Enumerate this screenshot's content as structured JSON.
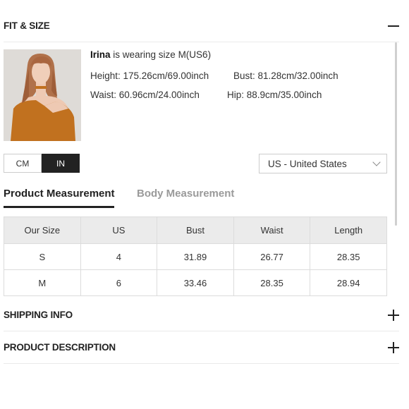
{
  "fit": {
    "title": "FIT & SIZE"
  },
  "model": {
    "name": "Irina",
    "wearing_text": "is wearing size M(US6)",
    "height": "Height: 175.26cm/69.00inch",
    "bust": "Bust: 81.28cm/32.00inch",
    "waist": "Waist: 60.96cm/24.00inch",
    "hip": "Hip: 88.9cm/35.00inch"
  },
  "units": {
    "cm": "CM",
    "in": "IN",
    "selected": "IN"
  },
  "country": {
    "selected": "US - United States"
  },
  "tabs": {
    "product": "Product Measurement",
    "body": "Body Measurement",
    "active": "product"
  },
  "table": {
    "headers": [
      "Our Size",
      "US",
      "Bust",
      "Waist",
      "Length"
    ],
    "rows": [
      [
        "S",
        "4",
        "31.89",
        "26.77",
        "28.35"
      ],
      [
        "M",
        "6",
        "33.46",
        "28.35",
        "28.94"
      ],
      [
        "",
        "",
        "",
        "",
        ""
      ]
    ]
  },
  "shipping": {
    "title": "SHIPPING INFO"
  },
  "description": {
    "title": "PRODUCT DESCRIPTION"
  },
  "colors": {
    "accent": "#222222",
    "inactive_tab": "#9a9a9a",
    "table_header_bg": "#ebebeb",
    "top_color": "#c1711f"
  }
}
